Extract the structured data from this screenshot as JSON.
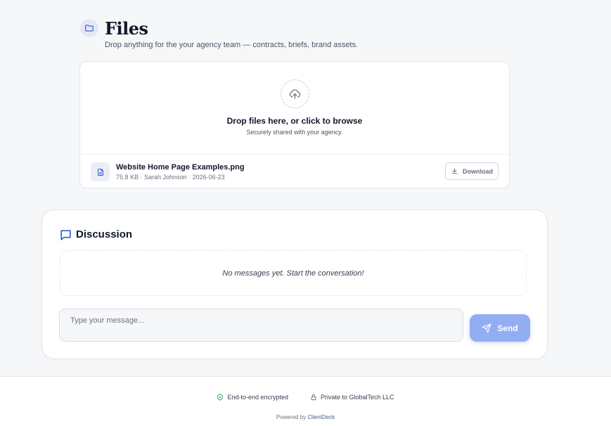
{
  "files": {
    "title": "Files",
    "subtitle": "Drop anything for the your agency team — contracts, briefs, brand assets.",
    "dropzone": {
      "title": "Drop files here, or click to browse",
      "subtitle": "Securely shared with your agency."
    },
    "items": [
      {
        "name": "Website Home Page Examples.png",
        "meta": "75.8 KB · Sarah Johnson · 2026-06-23",
        "action_label": "Download"
      }
    ]
  },
  "discussion": {
    "title": "Discussion",
    "empty_message": "No messages yet. Start the conversation!",
    "input_placeholder": "Type your message...",
    "input_value": "",
    "send_label": "Send"
  },
  "footer": {
    "encrypted_label": "End-to-end encrypted",
    "private_label": "Private to GlobalTech LLC",
    "separator": "·",
    "powered_prefix": "Powered by",
    "powered_brand": "ClientDeck"
  },
  "colors": {
    "accent": "#2f5bd3",
    "send_button": "#93adf3",
    "shield_green": "#16a34a"
  },
  "icons": {
    "files_header": "folder-icon",
    "dropzone": "cloud-upload-icon",
    "file_row": "document-icon",
    "download": "download-icon",
    "discussion": "chat-bubble-icon",
    "send": "paper-plane-icon",
    "encrypted": "shield-check-icon",
    "private": "lock-icon"
  }
}
